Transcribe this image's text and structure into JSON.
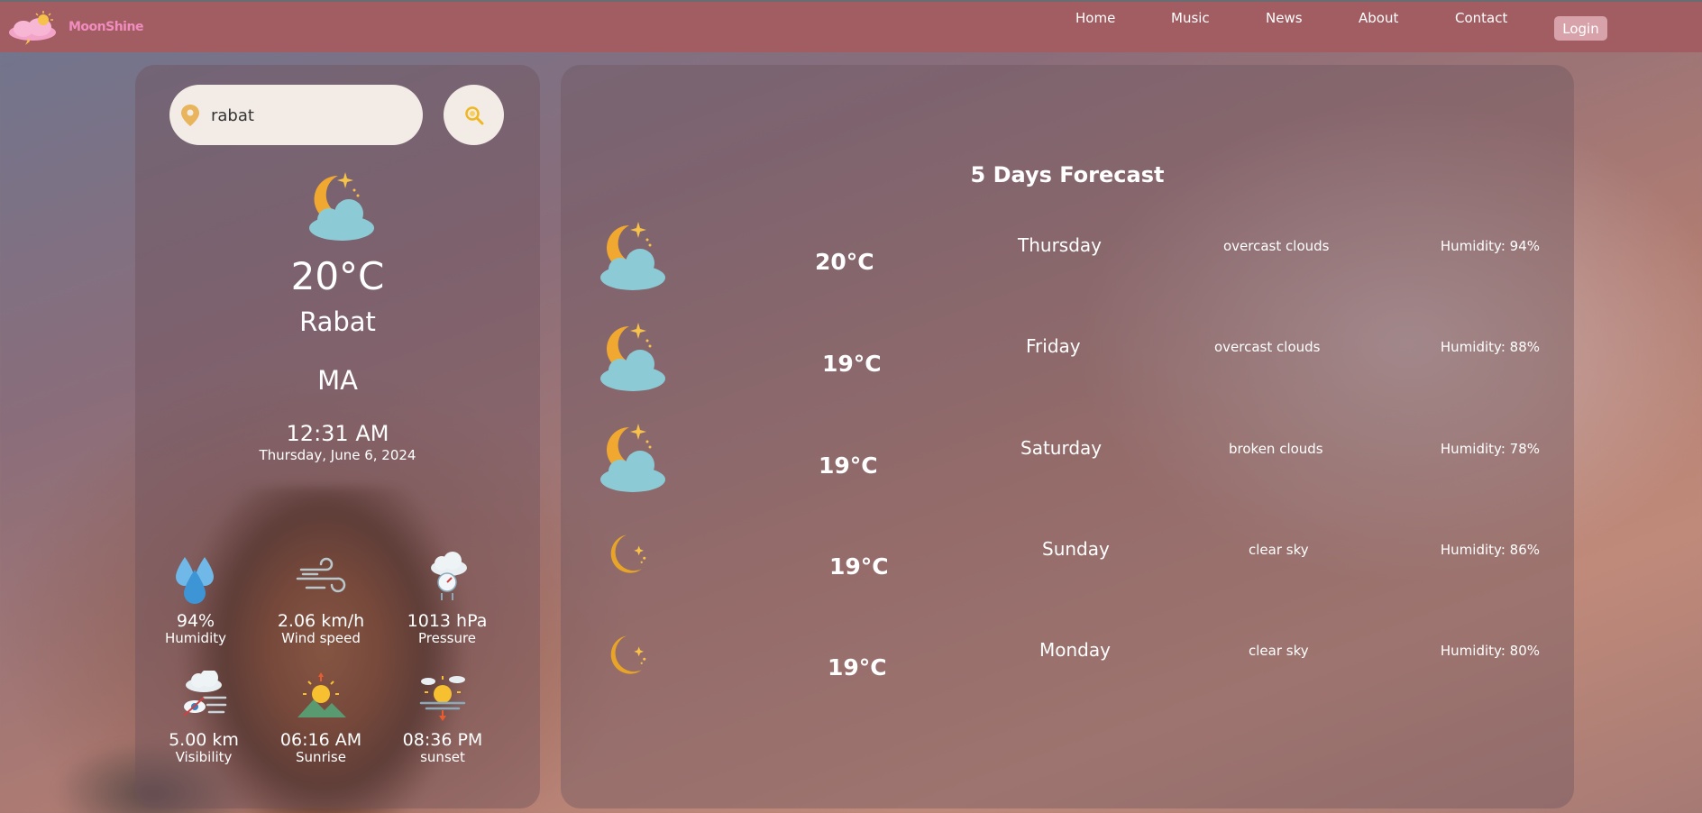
{
  "brand": {
    "name": "MoonShine"
  },
  "nav": {
    "items": [
      "Home",
      "Music",
      "News",
      "About",
      "Contact"
    ],
    "login": "Login"
  },
  "search": {
    "value": "rabat"
  },
  "current": {
    "temp": "20°C",
    "city": "Rabat",
    "country": "MA",
    "time": "12:31 AM",
    "date": "Thursday, June 6, 2024",
    "icon": "moon-cloud-icon"
  },
  "stats": [
    {
      "value": "94%",
      "label": "Humidity",
      "icon": "humidity-drops-icon"
    },
    {
      "value": "2.06 km/h",
      "label": "Wind speed",
      "icon": "wind-icon"
    },
    {
      "value": "1013 hPa",
      "label": "Pressure",
      "icon": "pressure-gauge-icon"
    },
    {
      "value": "5.00 km",
      "label": "Visibility",
      "icon": "visibility-icon"
    },
    {
      "value": "06:16 AM",
      "label": "Sunrise",
      "icon": "sunrise-icon"
    },
    {
      "value": "08:36 PM",
      "label": "sunset",
      "icon": "sunset-icon"
    }
  ],
  "forecast": {
    "title": "5 Days Forecast",
    "days": [
      {
        "temp": "20°C",
        "day": "Thursday",
        "desc": "overcast clouds",
        "humidity": "Humidity: 94%",
        "icon": "moon-cloud-icon"
      },
      {
        "temp": "19°C",
        "day": "Friday",
        "desc": "overcast clouds",
        "humidity": "Humidity: 88%",
        "icon": "moon-cloud-icon"
      },
      {
        "temp": "19°C",
        "day": "Saturday",
        "desc": "broken clouds",
        "humidity": "Humidity: 78%",
        "icon": "moon-cloud-icon"
      },
      {
        "temp": "19°C",
        "day": "Sunday",
        "desc": "clear sky",
        "humidity": "Humidity: 86%",
        "icon": "moon-icon"
      },
      {
        "temp": "19°C",
        "day": "Monday",
        "desc": "clear sky",
        "humidity": "Humidity: 80%",
        "icon": "moon-icon"
      }
    ]
  },
  "colors": {
    "navbar": "#a15d62",
    "login": "#d7a2aa",
    "moon": "#f0a830",
    "cloud": "#8ccbd6",
    "search_bg": "#f3ece6",
    "brand": "#f08cbe"
  }
}
